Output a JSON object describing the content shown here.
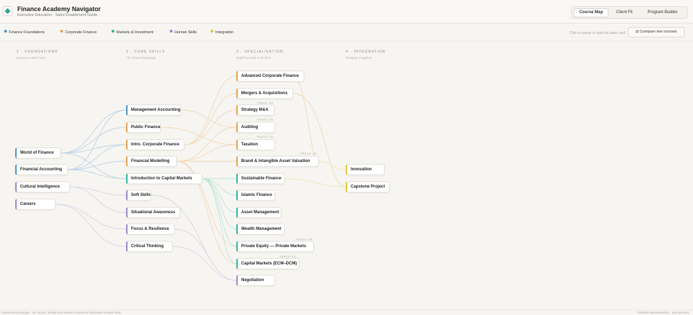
{
  "header": {
    "title": "Finance Academy Navigator",
    "subtitle": "Executive Education · Sales Enablement Guide",
    "views": [
      {
        "label": "Course Map",
        "active": true
      },
      {
        "label": "Client Fit",
        "active": false
      },
      {
        "label": "Program Builder",
        "active": false
      }
    ]
  },
  "filters": [
    {
      "label": "Finance Foundations",
      "color": "#4a90c8"
    },
    {
      "label": "Corporate Finance",
      "color": "#e8a24c"
    },
    {
      "label": "Markets & Investment",
      "color": "#2fb59a"
    },
    {
      "label": "Human Skills",
      "color": "#9b86c9"
    },
    {
      "label": "Integration",
      "color": "#d9c93a"
    }
  ],
  "toolbar": {
    "hint": "Click a course to open its sales card",
    "compare_label": "⇄ Compare two courses"
  },
  "stages": [
    {
      "title": "1 · FOUNDATIONS",
      "subtitle": "Everyone starts here"
    },
    {
      "title": "2 · CORE SKILLS",
      "subtitle": "The shared language"
    },
    {
      "title": "3 · SPECIALISATION",
      "subtitle": "Depth by track & function"
    },
    {
      "title": "4 · INTEGRATION",
      "subtitle": "Bringing it together"
    }
  ],
  "nodes": {
    "foundations": [
      {
        "label": "World of Finance",
        "color": "#4a90c8"
      },
      {
        "label": "Financial Accounting",
        "color": "#4a90c8"
      },
      {
        "label": "Cultural Intelligence",
        "color": "#9b86c9"
      },
      {
        "label": "Careers",
        "color": "#9b86c9"
      }
    ],
    "core": [
      {
        "label": "Management Accounting",
        "color": "#4a90c8"
      },
      {
        "label": "Public Finance",
        "color": "#e8a24c"
      },
      {
        "label": "Intro. Corporate Finance",
        "color": "#e8a24c"
      },
      {
        "label": "Financial Modelling",
        "color": "#e8a24c"
      },
      {
        "label": "Introduction to Capital Markets",
        "color": "#2fb59a"
      },
      {
        "label": "Soft Skills",
        "color": "#9b86c9"
      },
      {
        "label": "Situational Awareness",
        "color": "#9b86c9"
      },
      {
        "label": "Focus & Resilience",
        "color": "#9b86c9"
      },
      {
        "label": "Critical Thinking",
        "color": "#9b86c9"
      }
    ],
    "specialisation": [
      {
        "label": "Advanced Corporate Finance",
        "color": "#e8a24c",
        "track": ""
      },
      {
        "label": "Mergers & Acquisitions",
        "color": "#e8a24c",
        "track": ""
      },
      {
        "label": "Strategy M&A",
        "color": "#e8a24c",
        "track": "TRACK 3A"
      },
      {
        "label": "Auditing",
        "color": "#e8a24c",
        "track": "TRACK 1A"
      },
      {
        "label": "Taxation",
        "color": "#e8a24c",
        "track": "TRACK 1B"
      },
      {
        "label": "Brand & Intangible Asset Valuation",
        "color": "#e8a24c",
        "track": "TRACK 1C"
      },
      {
        "label": "Sustainable Finance",
        "color": "#2fb59a",
        "track": ""
      },
      {
        "label": "Islamic Finance",
        "color": "#2fb59a",
        "track": ""
      },
      {
        "label": "Asset Management",
        "color": "#2fb59a",
        "track": ""
      },
      {
        "label": "Wealth Management",
        "color": "#2fb59a",
        "track": ""
      },
      {
        "label": "Private Equity — Private Markets",
        "color": "#2fb59a",
        "track": "TRACK 2B"
      },
      {
        "label": "Capital Markets (ECM–DCM)",
        "color": "#2fb59a",
        "track": "TRACK 2C"
      },
      {
        "label": "Negotiation",
        "color": "#9b86c9",
        "track": ""
      }
    ],
    "integration": [
      {
        "label": "Innovation",
        "color": "#d9c93a"
      },
      {
        "label": "Capstone Project",
        "color": "#d9c93a"
      }
    ]
  },
  "footer": {
    "left": "Interactive prototype · all course, faculty and session content is illustrative sample data",
    "right": "Portfolio demonstration · anonymised"
  }
}
